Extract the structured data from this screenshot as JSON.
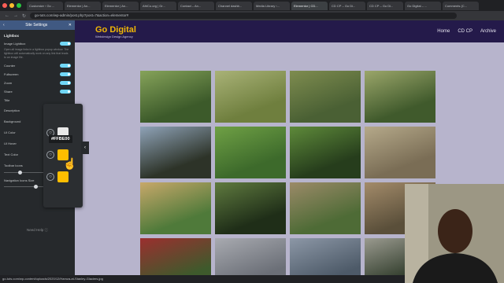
{
  "browser": {
    "tabs": [
      "Customize ‹ Go ...",
      "Elementor | An...",
      "Elementor | An...",
      "AfriCo.org | Gr...",
      "Contact – An...",
      "Channel dashb...",
      "Media Library ‹...",
      "Elementor | CD...",
      "CD CP – Go Di...",
      "CD CP – Go Di...",
      "Go Digital – ...",
      "Comments (C..."
    ],
    "active_tab_index": 7,
    "url": "go-tuts.com/wp-admin/post.php?post=7&action=elementor#"
  },
  "panel": {
    "title": "Site Settings",
    "section": "Lightbox",
    "image_lightbox_label": "Image Lightbox",
    "description": "Open all image links in a lightbox popup window. The lightbox will automatically work on any link that leads to an image file.",
    "toggles": [
      "Counter",
      "Fullscreen",
      "Zoom",
      "Share"
    ],
    "title_label": "Title",
    "labels_partial": [
      "Description",
      "Background",
      "UI Color",
      "UI Hover",
      "Text Color",
      "Toolbar Icons"
    ],
    "nav_icons_label": "Navigation Icons Size",
    "need_help": "Need Help",
    "tooltip": "#FFBE00"
  },
  "popover": {
    "swatches": [
      "#e9e9e9",
      "#ffbe00",
      "#ffbe00"
    ]
  },
  "site": {
    "logo_title": "Go Digital",
    "logo_subtitle": "Webdesign Design Agency",
    "nav": [
      "Home",
      "CD CP",
      "Archive"
    ]
  },
  "gallery_colors": [
    [
      "#3c5a2a",
      "#86a35a"
    ],
    [
      "#6f7f3e",
      "#a9b277"
    ],
    [
      "#4a6034",
      "#7e8c4f"
    ],
    [
      "#405a2c",
      "#9ba66a"
    ],
    [
      "#2d3328",
      "#8fa3b8"
    ],
    [
      "#3d6a2b",
      "#6fa045"
    ],
    [
      "#263d1c",
      "#5e8a3a"
    ],
    [
      "#7a6d55",
      "#b5a98a"
    ],
    [
      "#4f7a3a",
      "#c7a86a"
    ],
    [
      "#1f2e18",
      "#5f7a3f"
    ],
    [
      "#4e6b36",
      "#9b8a68"
    ],
    [
      "#5a4f3a",
      "#a38b6a"
    ],
    [
      "#3e5a2c",
      "#9b2f2f"
    ],
    [
      "#6b6f77",
      "#a8aab0"
    ],
    [
      "#4d5a68",
      "#8c97a6"
    ],
    [
      "#2f3b2a",
      "#9a9a8f"
    ]
  ],
  "status": "go-tuts.com/wp-content/uploads/2020/12/Hamza-at-Stanley-Glaciers.jpg"
}
